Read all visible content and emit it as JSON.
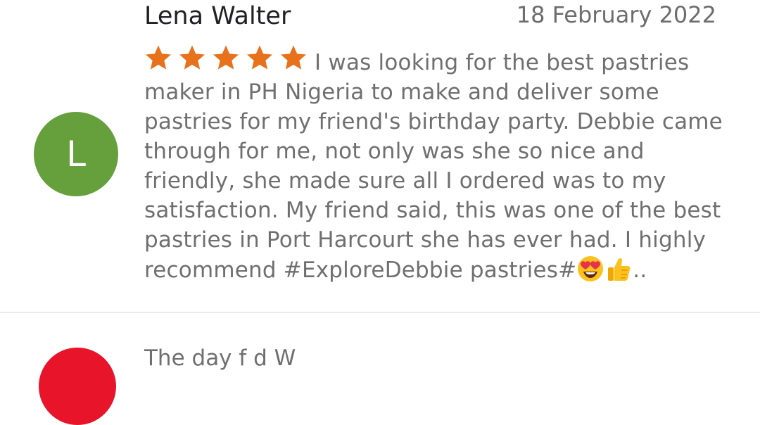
{
  "review": {
    "avatar_letter": "L",
    "avatar_color": "#66a03c",
    "author": "Lena Walter",
    "date": "18 February 2022",
    "rating": 5,
    "star_color": "#e8711c",
    "text": "I was looking for the best pastries maker in PH Nigeria to make and deliver some pastries for my friend's birthday party. Debbie came through for me, not only was she so nice and friendly,  she made sure all I ordered  was to my satisfaction. My friend said,  this was one of the best pastries in Port Harcourt  she has ever had. I highly recommend #ExploreDebbie pastries#",
    "emojis": [
      "heart-eyes-emoji",
      "thumbs-up-emoji"
    ],
    "suffix": ".."
  },
  "next_review": {
    "avatar_color": "#e8142a",
    "text_start": "The  day  f    d                                                    W"
  }
}
